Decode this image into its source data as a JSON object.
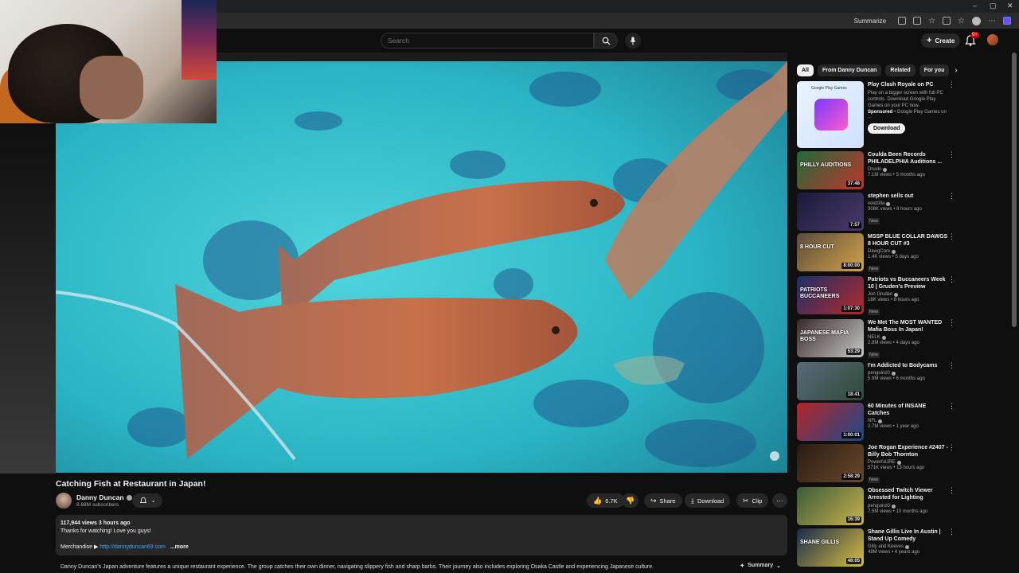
{
  "browser": {
    "summarize_label": "Summarize",
    "window_controls": [
      "–",
      "▢",
      "✕"
    ]
  },
  "header": {
    "search_placeholder": "Search",
    "create_label": "Create",
    "notifications_count": "9+"
  },
  "video": {
    "title": "Catching Fish at Restaurant in Japan!",
    "channel_name": "Danny Duncan",
    "subscribers": "8.68M subscribers",
    "likes": "6.7K",
    "share_label": "Share",
    "download_label": "Download",
    "clip_label": "Clip",
    "description": {
      "views_and_time": "117,944 views  3 hours ago",
      "line1": "Thanks for watching! Love you guys!",
      "merch_label": "Merchandise ▶",
      "merch_link": "http://dannyduncan69.com",
      "more_label": "...more"
    },
    "ai_summary": "Danny Duncan's Japan adventure features a unique restaurant experience. The group catches their own dinner, navigating slippery fish and sharp barbs. Their journey also includes exploring Osaka Castle and experiencing Japanese culture.",
    "summary_label": "Summary"
  },
  "sidebar": {
    "chips": [
      "All",
      "From Danny Duncan",
      "Related",
      "For you"
    ],
    "ad": {
      "title": "Play Clash Royale on PC",
      "desc": "Play on a bigger screen with full PC controls. Download Google Play Games on your PC now.",
      "sponsored": "Sponsored",
      "advertiser": "• Google Play Games on ...",
      "button": "Download",
      "thumb_label": "Google Play Games"
    },
    "items": [
      {
        "title": "Coulda Been Records PHILADELPHIA Auditions ...",
        "channel": "Druski",
        "stats": "7.1M views • 5 months ago",
        "duration": "37:48",
        "new": "",
        "thumb_colors": [
          "#1f6a3a",
          "#c3342d"
        ],
        "thumb_text": "PHILLY AUDITIONS"
      },
      {
        "title": "stephen sells out",
        "channel": "voidzilla",
        "stats": "308K views • 8 hours ago",
        "duration": "7:57",
        "new": "New",
        "thumb_colors": [
          "#1a1a3a",
          "#4b3a6a"
        ],
        "thumb_text": ""
      },
      {
        "title": "MSSP BLUE COLLAR DAWGS 8 HOUR CUT #3",
        "channel": "DawgCore",
        "stats": "1.4K views • 5 days ago",
        "duration": "8:00:00",
        "new": "New",
        "thumb_colors": [
          "#5a4a3a",
          "#d3a34a"
        ],
        "thumb_text": "8 HOUR CUT"
      },
      {
        "title": "Patriots vs Buccaneers Week 10 | Gruden's Preview",
        "channel": "Jon Gruden",
        "stats": "16K views • 8 hours ago",
        "duration": "1:07:30",
        "new": "New",
        "thumb_colors": [
          "#1c2f6b",
          "#b52a2a"
        ],
        "thumb_text": "PATRIOTS BUCCANEERS"
      },
      {
        "title": "We Met The MOST WANTED Mafia Boss In Japan!",
        "channel": "NELK",
        "stats": "2.8M views • 4 days ago",
        "duration": "53:29",
        "new": "New",
        "thumb_colors": [
          "#3a2a2a",
          "#c8c8c8"
        ],
        "thumb_text": "JAPANESE MAFIA BOSS"
      },
      {
        "title": "I'm Addicted to Bodycams",
        "channel": "penguinz0",
        "stats": "5.9M views • 6 months ago",
        "duration": "18:41",
        "new": "",
        "thumb_colors": [
          "#5a6a7a",
          "#2f4a3a"
        ],
        "thumb_text": ""
      },
      {
        "title": "60 Minutes of INSANE Catches",
        "channel": "NFL",
        "stats": "2.7M views • 1 year ago",
        "duration": "1:00:01",
        "new": "",
        "thumb_colors": [
          "#b5262a",
          "#1a4a8a"
        ],
        "thumb_text": ""
      },
      {
        "title": "Joe Rogan Experience #2407 - Billy Bob Thornton",
        "channel": "PowerfulJRE",
        "stats": "571K views • 13 hours ago",
        "duration": "2:58:29",
        "new": "New",
        "thumb_colors": [
          "#2a1a14",
          "#6a4a2a"
        ],
        "thumb_text": ""
      },
      {
        "title": "Obsessed Twitch Viewer Arrested for Lighting Streamer...",
        "channel": "penguinz0",
        "stats": "7.5M views • 10 months ago",
        "duration": "16:39",
        "new": "",
        "thumb_colors": [
          "#3a5a3a",
          "#c9b24a"
        ],
        "thumb_text": ""
      },
      {
        "title": "Shane Gillis Live In Austin | Stand Up Comedy",
        "channel": "Gilly and Keeves",
        "stats": "48M views • 4 years ago",
        "duration": "48:05",
        "new": "",
        "thumb_colors": [
          "#1a2a4a",
          "#d8c040"
        ],
        "thumb_text": "SHANE GILLIS"
      }
    ]
  }
}
